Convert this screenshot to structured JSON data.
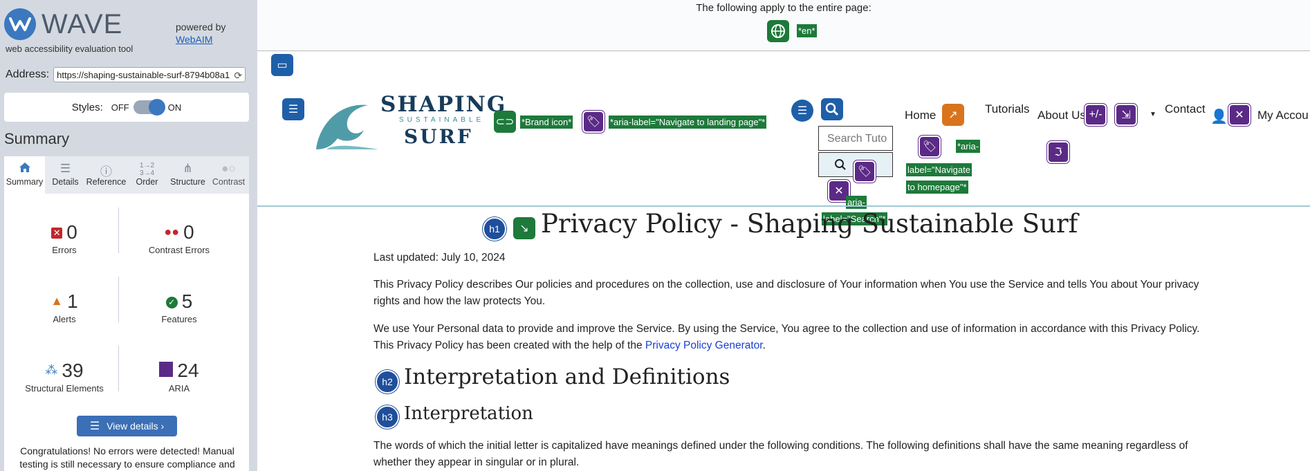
{
  "wave": {
    "brand": "WAVE",
    "tagline": "web accessibility evaluation tool",
    "powered_by": "powered by",
    "webaim_link": "WebAIM",
    "address_label": "Address:",
    "address_value": "https://shaping-sustainable-surf-8794b08a1",
    "styles_label": "Styles:",
    "styles_off": "OFF",
    "styles_on": "ON",
    "summary_heading": "Summary",
    "tabs": [
      {
        "label": "Summary",
        "icon": "home-icon"
      },
      {
        "label": "Details",
        "icon": "list-icon"
      },
      {
        "label": "Reference",
        "icon": "info-icon"
      },
      {
        "label": "Order",
        "icon": "order-icon"
      },
      {
        "label": "Structure",
        "icon": "structure-icon"
      },
      {
        "label": "Contrast",
        "icon": "contrast-icon"
      }
    ],
    "stats": {
      "errors": {
        "count": "0",
        "label": "Errors"
      },
      "contrast_errors": {
        "count": "0",
        "label": "Contrast Errors"
      },
      "alerts": {
        "count": "1",
        "label": "Alerts"
      },
      "features": {
        "count": "5",
        "label": "Features"
      },
      "structural": {
        "count": "39",
        "label": "Structural Elements"
      },
      "aria": {
        "count": "24",
        "label": "ARIA"
      }
    },
    "view_details": "View details ›",
    "congrats": "Congratulations! No errors were detected! Manual testing is still necessary to ensure compliance and"
  },
  "page": {
    "entire_page_text": "The following apply to the entire page:",
    "lang_label": "*en*",
    "brand_line1": "SHAPING",
    "brand_line2": "SUSTAINABLE",
    "brand_line3": "SURF",
    "brand_icon_label": "*Brand icon*",
    "landing_label": "*aria-label=\"Navigate to landing page\"*",
    "search_placeholder": "Search Tuto",
    "homepage_label_1": "*aria-",
    "homepage_label_2": "label=\"Navigate",
    "homepage_label_3": "to homepage\"*",
    "search_label_1": "aria-",
    "search_label_2": "label=\"Search\"*",
    "nav": {
      "home": "Home",
      "tutorials": "Tutorials",
      "about": "About Us",
      "contact": "Contact",
      "account": "My Accou"
    },
    "h1_badge": "h1",
    "h2_badge": "h2",
    "h3_badge": "h3",
    "title": "Privacy Policy - Shaping Sustainable Surf",
    "last_updated": "Last updated: July 10, 2024",
    "para1": "This Privacy Policy describes Our policies and procedures on the collection, use and disclosure of Your information when You use the Service and tells You about Your privacy rights and how the law protects You.",
    "para2_pre": "We use Your Personal data to provide and improve the Service. By using the Service, You agree to the collection and use of information in accordance with this Privacy Policy. This Privacy Policy has been created with the help of the ",
    "para2_link": "Privacy Policy Generator",
    "para2_post": ".",
    "h2": "Interpretation and Definitions",
    "h3": "Interpretation",
    "para3": "The words of which the initial letter is capitalized have meanings defined under the following conditions. The following definitions shall have the same meaning regardless of whether they appear in singular or in plural."
  },
  "colors": {
    "wave_blue": "#3b78bf",
    "feature_green": "#1d7a3a",
    "aria_purple": "#5b2a86",
    "structure_blue": "#1f4f9c",
    "alert_orange": "#d9741c",
    "error_red": "#c0282d"
  }
}
